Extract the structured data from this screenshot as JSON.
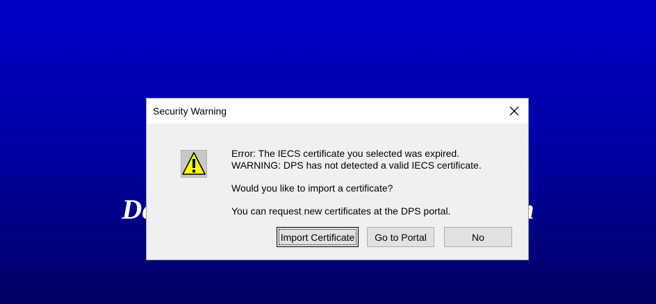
{
  "background": {
    "title": "Department of Public Safety System",
    "colors": {
      "top": "#0000c8",
      "bottom": "#000066"
    }
  },
  "dialog": {
    "title": "Security Warning",
    "icon": "warning-icon",
    "messages": {
      "error": "Error: The IECS certificate you selected was expired.",
      "warning": "WARNING: DPS has not detected a valid IECS certificate.",
      "question": "Would you like to import a certificate?",
      "info": "You can request new certificates at the DPS portal."
    },
    "buttons": {
      "import": "Import Certificate",
      "portal": "Go to Portal",
      "no": "No"
    }
  }
}
